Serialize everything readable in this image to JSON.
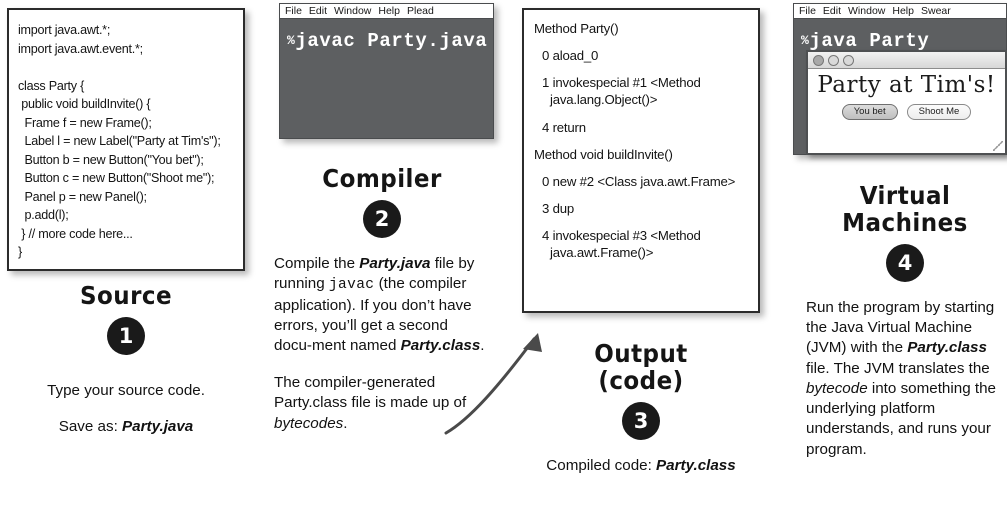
{
  "source_panel": {
    "code": "import java.awt.*;\nimport java.awt.event.*;\n\nclass Party {\n public void buildInvite() {\n  Frame f = new Frame();\n  Label l = new Label(\"Party at Tim's\");\n  Button b = new Button(\"You bet\");\n  Button c = new Button(\"Shoot me\");\n  Panel p = new Panel();\n  p.add(l);\n } // more code here...\n}"
  },
  "source_caption": {
    "title": "Source",
    "step": "1",
    "line_a": "Type your source code.",
    "line_b_prefix": "Save as: ",
    "line_b_file": "Party.java"
  },
  "compiler_terminal": {
    "menu": [
      "File",
      "Edit",
      "Window",
      "Help",
      "Plead"
    ],
    "prompt": "%",
    "command": "javac Party.java"
  },
  "compiler_caption": {
    "title": "Compiler",
    "step": "2",
    "para1_a": "Compile the ",
    "para1_file": "Party.java",
    "para1_b": " file by running ",
    "para1_cmd": "javac",
    "para1_c": " (the compiler application). If you don’t have  errors, you’ll get a second docu-ment named ",
    "para1_file2": "Party.class",
    "para1_d": ".",
    "para2_a": "The compiler-generated Party.class file is made up of ",
    "para2_em": "bytecodes",
    "para2_b": "."
  },
  "output_panel": {
    "lines": [
      {
        "text": "Method Party()",
        "indent": false
      },
      {
        "text": "0 aload_0",
        "indent": true
      },
      {
        "text": "1 invokespecial #1 <Method java.lang.Object()>",
        "indent": true
      },
      {
        "text": "4 return",
        "indent": true
      },
      {
        "text": "Method void buildInvite()",
        "indent": false
      },
      {
        "text": "0 new #2 <Class java.awt.Frame>",
        "indent": true
      },
      {
        "text": "3 dup",
        "indent": true
      },
      {
        "text": "4 invokespecial #3 <Method java.awt.Frame()>",
        "indent": true
      }
    ]
  },
  "output_caption": {
    "title_line1": "Output",
    "title_line2": "(code)",
    "step": "3",
    "line_prefix": "Compiled code: ",
    "line_file": "Party.class"
  },
  "jvm_terminal": {
    "menu": [
      "File",
      "Edit",
      "Window",
      "Help",
      "Swear"
    ],
    "prompt": "%",
    "command": "java Party"
  },
  "party_window": {
    "label": "Party at Tim's!",
    "button_primary": "You bet",
    "button_secondary": "Shoot Me",
    "dots": [
      "minimize-dot",
      "zoom-dot",
      "close-dot"
    ]
  },
  "vm_caption": {
    "title_line1": "Virtual",
    "title_line2": "Machines",
    "step": "4",
    "para_a": "Run the program by starting the Java Virtual Machine (JVM) with the ",
    "para_file": "Party.class",
    "para_b": " file. The JVM translates the ",
    "para_em": "bytecode",
    "para_c": " into something the underlying platform understands, and runs your program."
  },
  "colors": {
    "terminal_bg": "#5d5f61",
    "panel_border": "#2b2b2b",
    "badge_bg": "#1a1a1a",
    "text": "#121212"
  }
}
